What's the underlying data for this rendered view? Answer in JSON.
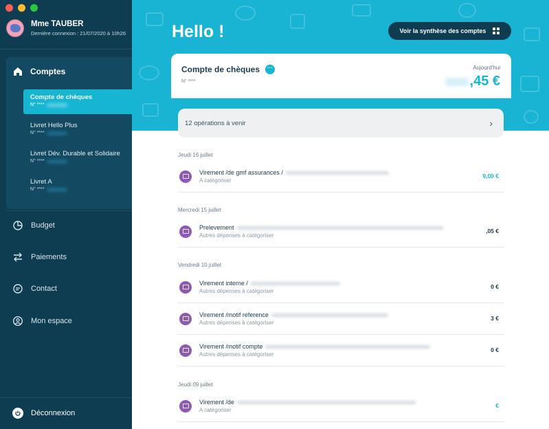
{
  "user": {
    "name": "Mme TAUBER",
    "last_login": "Dernière connexion : 21/07/2020 à 10h26"
  },
  "nav": {
    "comptes_label": "Comptes",
    "accounts": [
      {
        "name": "Compte de chèques",
        "number": "N° ****",
        "active": true
      },
      {
        "name": "Livret Hello Plus",
        "number": "N° ****",
        "active": false
      },
      {
        "name": "Livret Dév. Durable et Solidaire",
        "number": "N° ****",
        "active": false
      },
      {
        "name": "Livret A",
        "number": "N° ****",
        "active": false
      }
    ],
    "menu": [
      {
        "label": "Budget",
        "icon": "pie-chart-icon"
      },
      {
        "label": "Paiements",
        "icon": "transfer-arrows-icon"
      },
      {
        "label": "Contact",
        "icon": "chat-bubble-icon"
      },
      {
        "label": "Mon espace",
        "icon": "user-circle-icon"
      }
    ],
    "logout_label": "Déconnexion"
  },
  "header": {
    "greeting": "Hello !",
    "synthesis_button": "Voir la synthèse des comptes"
  },
  "account_card": {
    "title": "Compte de chèques",
    "number": "N° ****",
    "date_label": "Aujourd'hui",
    "balance_visible": ",45 €"
  },
  "upcoming": {
    "label": "12 opérations à venir"
  },
  "transactions": [
    {
      "date": "Jeudi 16 juillet",
      "items": [
        {
          "label": "Virement /de gmf assurances /",
          "category": "A catégoriser",
          "amount": "9,00 €",
          "positive": true
        }
      ]
    },
    {
      "date": "Mercredi 15 juillet",
      "items": [
        {
          "label": "Prelevement",
          "category": "Autres dépenses à catégoriser",
          "amount": ",05 €",
          "positive": false
        }
      ]
    },
    {
      "date": "Vendredi 10 juillet",
      "items": [
        {
          "label": "Virement interne /",
          "category": "Autres dépenses à catégoriser",
          "amount": "0 €",
          "positive": false
        },
        {
          "label": "Virement /motif reference",
          "category": "Autres dépenses à catégoriser",
          "amount": "3 €",
          "positive": false
        },
        {
          "label": "Virement /motif compte",
          "category": "Autres dépenses à catégoriser",
          "amount": "0 €",
          "positive": false
        }
      ]
    },
    {
      "date": "Jeudi 09 juillet",
      "items": [
        {
          "label": "Virement /de",
          "category": "A catégoriser",
          "amount": "€",
          "positive": true
        }
      ]
    }
  ],
  "colors": {
    "sidebar": "#0e3d52",
    "accent": "#16b6d3",
    "banner": "#19b4d4",
    "category_icon": "#8e57b9"
  }
}
